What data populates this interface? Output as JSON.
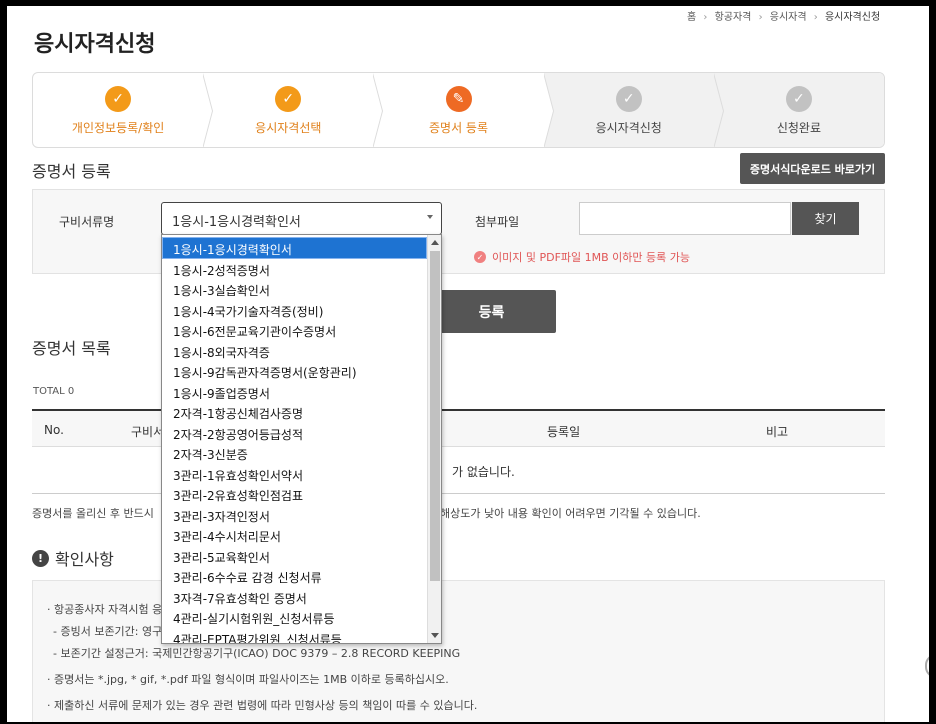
{
  "breadcrumb": {
    "home": "홈",
    "sep": "›",
    "level1": "항공자격",
    "level2": "응시자격",
    "current": "응시자격신청"
  },
  "page_title": "응시자격신청",
  "steps": [
    {
      "label": "개인정보등록/확인",
      "state": "done"
    },
    {
      "label": "응시자격선택",
      "state": "done"
    },
    {
      "label": "증명서 등록",
      "state": "active"
    },
    {
      "label": "응시자격신청",
      "state": "todo"
    },
    {
      "label": "신청완료",
      "state": "todo"
    }
  ],
  "cert_section": {
    "title": "증명서 등록",
    "download_button": "증명서식다운로드 바로가기",
    "doc_label": "구비서류명",
    "select_value": "1응시-1응시경력확인서",
    "attach_label": "첨부파일",
    "find_button": "찾기",
    "file_note": "이미지 및 PDF파일 1MB 이하만 등록 가능",
    "register_button": "등록"
  },
  "dropdown": {
    "options": [
      "1응시-1응시경력확인서",
      "1응시-2성적증명서",
      "1응시-3실습확인서",
      "1응시-4국가기술자격증(정비)",
      "1응시-6전문교육기관이수증명서",
      "1응시-8외국자격증",
      "1응시-9감독관자격증명서(운항관리)",
      "1응시-9졸업증명서",
      "2자격-1항공신체검사증명",
      "2자격-2항공영어등급성적",
      "2자격-3신분증",
      "3관리-1유효성확인서약서",
      "3관리-2유효성확인점검표",
      "3관리-3자격인정서",
      "3관리-4수시처리문서",
      "3관리-5교육확인서",
      "3관리-6수수료 감경 신청서류",
      "3자격-7유효성확인 증명서",
      "4관리-실기시험위원_신청서류등",
      "4관리-EPTA평가위원_신청서류등"
    ]
  },
  "list_section": {
    "title": "증명서 목록",
    "total": "TOTAL 0",
    "col_no": "No.",
    "col_doc": "구비서",
    "col_date": "등록일",
    "col_note": "비고",
    "empty_text": "가 없습니다.",
    "info_left": "증명서를 올리신 후 반드시",
    "info_right": "해상도가 낮아 내용 확인이 어려우면 기각될 수 있습니다."
  },
  "confirm": {
    "icon": "!",
    "title": "확인사항",
    "line1": "· 항공종사자 자격시험 응",
    "line2": "- 증빙서 보존기간: 영구",
    "line3": "- 보존기간 설정근거: 국제민간항공기구(ICAO) DOC 9379 – 2.8 RECORD KEEPING",
    "line4": "· 증명서는 *.jpg, * gif, *.pdf 파일 형식이며 파일사이즈는 1MB 이하로 등록하십시오.",
    "line5": "· 제출하신 서류에 문제가 있는 경우 관련 법령에 따라 민형사상 등의 책임이 따를 수 있습니다."
  },
  "icons": {
    "check": "✓",
    "pencil": "✎",
    "alert": "!"
  },
  "colors": {
    "done": "#f39a19",
    "active": "#ee6a24",
    "todo": "#c2c2c2",
    "selected": "#1e73d2",
    "note": "#e05555"
  }
}
